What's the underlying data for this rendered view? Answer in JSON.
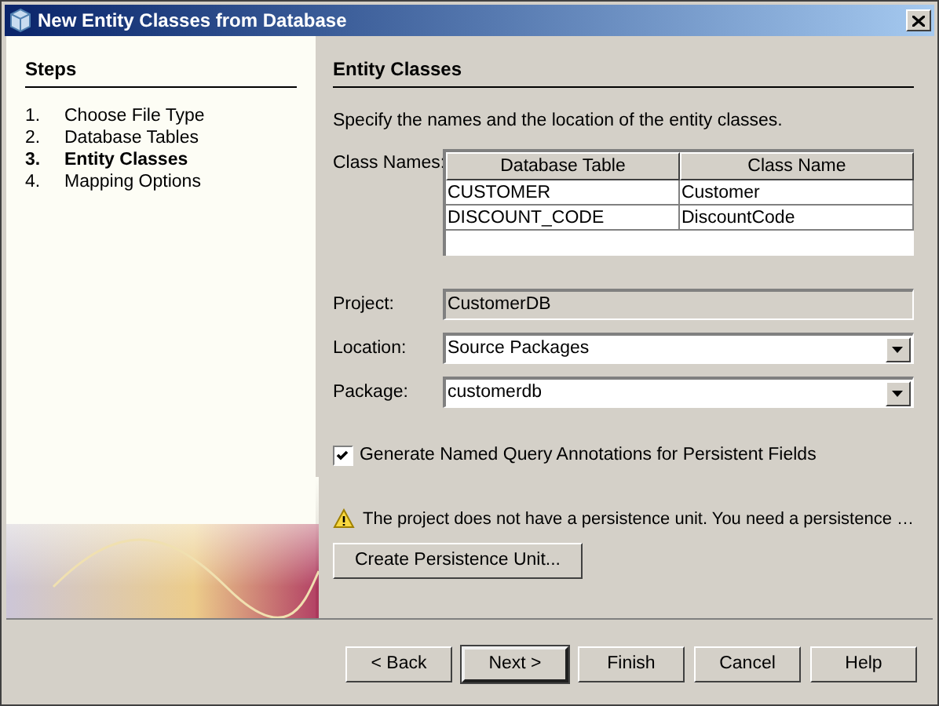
{
  "window": {
    "title": "New Entity Classes from Database"
  },
  "steps": {
    "title": "Steps",
    "items": [
      {
        "number": "1.",
        "label": "Choose File Type",
        "selected": false
      },
      {
        "number": "2.",
        "label": "Database Tables",
        "selected": false
      },
      {
        "number": "3.",
        "label": "Entity Classes",
        "selected": true
      },
      {
        "number": "4.",
        "label": "Mapping Options",
        "selected": false
      }
    ]
  },
  "panel": {
    "title": "Entity Classes",
    "description": "Specify the names and the location of the entity classes.",
    "class_names_label": "Class Names:",
    "table": {
      "columns": [
        "Database Table",
        "Class Name"
      ],
      "rows": [
        [
          "CUSTOMER",
          "Customer"
        ],
        [
          "DISCOUNT_CODE",
          "DiscountCode"
        ]
      ]
    },
    "fields": [
      {
        "kind": "readonly",
        "label": "Project:",
        "value": "CustomerDB"
      },
      {
        "kind": "combo",
        "label": "Location:",
        "value": "Source Packages"
      },
      {
        "kind": "combo",
        "label": "Package:",
        "value": "customerdb"
      }
    ],
    "checkbox": {
      "label": "Generate Named Query Annotations for Persistent Fields",
      "checked": true
    },
    "warning": "The project does not have a persistence unit. You need a persistence …",
    "create_button": "Create Persistence Unit..."
  },
  "buttons": [
    {
      "label": "< Back",
      "default": false
    },
    {
      "label": "Next >",
      "default": true
    },
    {
      "label": "Finish",
      "default": false
    },
    {
      "label": "Cancel",
      "default": false
    },
    {
      "label": "Help",
      "default": false
    }
  ]
}
